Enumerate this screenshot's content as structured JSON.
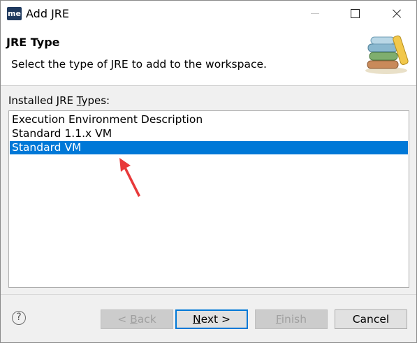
{
  "window": {
    "title": "Add JRE",
    "app_icon_text": "me"
  },
  "banner": {
    "title": "JRE Type",
    "description": "Select the type of JRE to add to the workspace.",
    "graphic": "jre-books-icon"
  },
  "list": {
    "label_pre": "Installed JRE ",
    "label_mnemonic": "T",
    "label_post": "ypes:",
    "items": [
      "Execution Environment Description",
      "Standard 1.1.x VM",
      "Standard VM"
    ],
    "selected_index": 2
  },
  "buttons": {
    "back_pre": "< ",
    "back_mnemonic": "B",
    "back_post": "ack",
    "next_mnemonic": "N",
    "next_post": "ext >",
    "finish_mnemonic": "F",
    "finish_post": "inish",
    "cancel": "Cancel"
  },
  "help_icon": "?",
  "colors": {
    "selection": "#0078d7",
    "annotation_arrow": "#e8393a",
    "dialog_bg": "#f0f0f0"
  }
}
